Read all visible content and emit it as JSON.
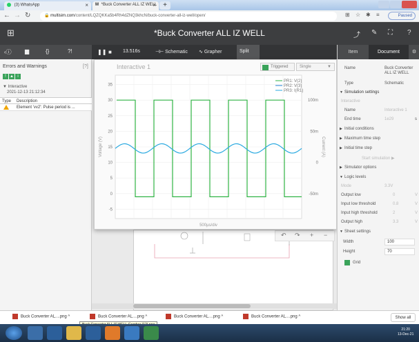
{
  "browser": {
    "tabs": [
      {
        "label": "(3) WhatsApp"
      },
      {
        "label": "*Buck Converter ALL IZ WELL"
      }
    ],
    "new_tab": "+",
    "url_domain": "multisim.com",
    "url_path": "/content/LQZQKKa5b4Rh4dZNQ3khcN/buck-converter-all-iz-well/open/",
    "paused_label": "Paused"
  },
  "app": {
    "title": "*Buck Converter ALL IZ WELL"
  },
  "sim_toolbar": {
    "time": "13.516s",
    "schematic_label": "Schematic",
    "grapher_label": "Grapher",
    "split_label": "Split"
  },
  "left_panel": {
    "title": "Errors and Warnings",
    "count": "[?]",
    "group_title": "Interactive",
    "group_time": "2021-12-13 21:12:34",
    "col_type": "Type",
    "col_desc": "Description",
    "error_text": "Element 'vv2': Pulse period is ..."
  },
  "graph": {
    "title": "Interactive 1",
    "triggered_label": "Triggered",
    "single_label": "Single",
    "xlabel": "500µs/div",
    "ylabel_left": "Voltage (V)",
    "ylabel_right": "Current (A)"
  },
  "chart_data": {
    "type": "line",
    "left_axis": {
      "ticks": [
        35,
        30,
        25,
        20,
        15,
        10,
        5,
        0,
        -5
      ],
      "ylim": [
        -8,
        38
      ],
      "label": "Voltage (V)"
    },
    "right_axis": {
      "ticks": [
        "100m",
        "50m",
        "0",
        "-50m"
      ],
      "label": "Current (A)"
    },
    "x_label": "500µs/div",
    "series": [
      {
        "name": "PR1: V(2)",
        "color": "#2fb344",
        "kind": "square",
        "high": 30,
        "low": -1,
        "period": 2,
        "duty": 0.5
      },
      {
        "name": "PR2: V(3)",
        "color": "#1e7fd0",
        "kind": "line",
        "values": []
      },
      {
        "name": "PR3: I(R1)",
        "color": "#2aa9e0",
        "kind": "sine",
        "center": 14.5,
        "amplitude": 1.5
      }
    ],
    "grid": true,
    "legend": "top-right"
  },
  "graph_controls": [
    "↶",
    "↷",
    "+",
    "−"
  ],
  "right_panel": {
    "tabs": [
      "Item",
      "Document"
    ],
    "name_label": "Name",
    "name_value": "Buck Converter ALL IZ WELL",
    "type_label": "Type",
    "type_value": "Schematic",
    "sim_settings": "Simulation settings",
    "interactive": "Interactive",
    "sim_name_label": "Name",
    "sim_name_value": "Interactive 1",
    "end_time_label": "End time",
    "end_time_value": "1e29",
    "end_time_unit": "s",
    "initial_conditions": "Initial conditions",
    "max_time_step": "Maximum time step",
    "initial_time_step": "Initial time step",
    "start_sim": "Start simulation ▶",
    "simulator_options": "Simulator options",
    "logic_levels": "Logic levels",
    "mode_label": "Mode",
    "mode_value": "3.3V",
    "output_low_label": "Output low",
    "output_low_value": "0",
    "input_low_label": "Input low threshold",
    "input_low_value": "0.8",
    "input_high_label": "Input high threshold",
    "input_high_value": "2",
    "output_high_label": "Output high",
    "output_high_value": "3.3",
    "unit_v": "V",
    "sheet_settings": "Sheet settings",
    "width_label": "Width",
    "width_value": "100",
    "height_label": "Height",
    "height_value": "70",
    "grid_label": "Grid"
  },
  "downloads": {
    "items": [
      "Buck Converter AL....png",
      "Buck Converter AL....png",
      "Buck Converter AL....png",
      "Buck Converter AL....png"
    ],
    "tooltip": "Buck Converter ALL IZ WELL-Grapher (12).png",
    "show_all": "Show all"
  },
  "clock": {
    "time": "21:20",
    "date": "13-Dec-21"
  }
}
